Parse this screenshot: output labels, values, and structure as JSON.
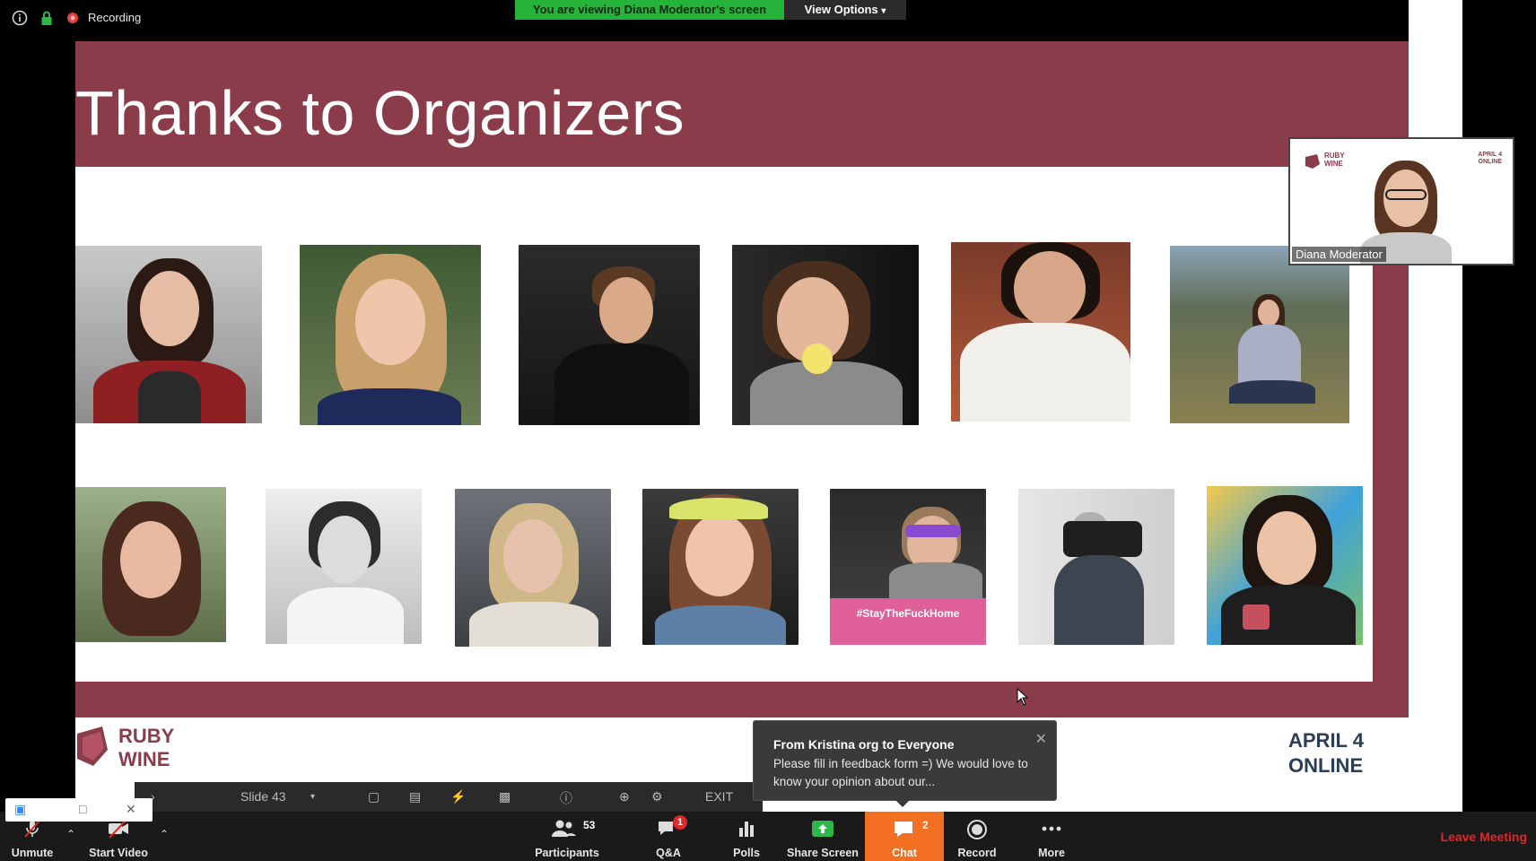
{
  "top_bar": {
    "recording_label": "Recording",
    "viewing_banner": "You are viewing Diana Moderator's screen",
    "view_options_label": "View Options"
  },
  "slide": {
    "title": "Thanks to Organizers",
    "logo_line1": "RUBY",
    "logo_line2": "WINE",
    "date_line1": "APRIL 4",
    "date_line2": "ONLINE",
    "row1_photos": [
      "organizer-1",
      "organizer-2",
      "organizer-3",
      "organizer-4",
      "organizer-5",
      "organizer-6"
    ],
    "row2_photos": [
      "organizer-7",
      "organizer-8",
      "organizer-9",
      "organizer-10",
      "organizer-11",
      "organizer-12",
      "organizer-13"
    ],
    "sign_text": "#StayTheFuckHome"
  },
  "slideshow_controls": {
    "slide_label": "Slide 43",
    "exit_label": "EXIT"
  },
  "video_thumb": {
    "name": "Diana Moderator",
    "logo_text": "RUBY WINE",
    "date_text": "APRIL 4 ONLINE"
  },
  "chat_popup": {
    "from": "From Kristina org to Everyone",
    "message": "Please fill in feedback form =) We would love to know your opinion about our..."
  },
  "toolbar": {
    "unmute": "Unmute",
    "start_video": "Start Video",
    "participants": "Participants",
    "participants_count": "53",
    "qa": "Q&A",
    "qa_badge": "1",
    "polls": "Polls",
    "share_screen": "Share Screen",
    "chat": "Chat",
    "chat_count": "2",
    "record": "Record",
    "more": "More",
    "leave": "Leave Meeting"
  },
  "colors": {
    "slide_accent": "#8a3c4a",
    "banner_green": "#26b33a",
    "chat_orange": "#f36f21",
    "leave_red": "#e02828"
  }
}
